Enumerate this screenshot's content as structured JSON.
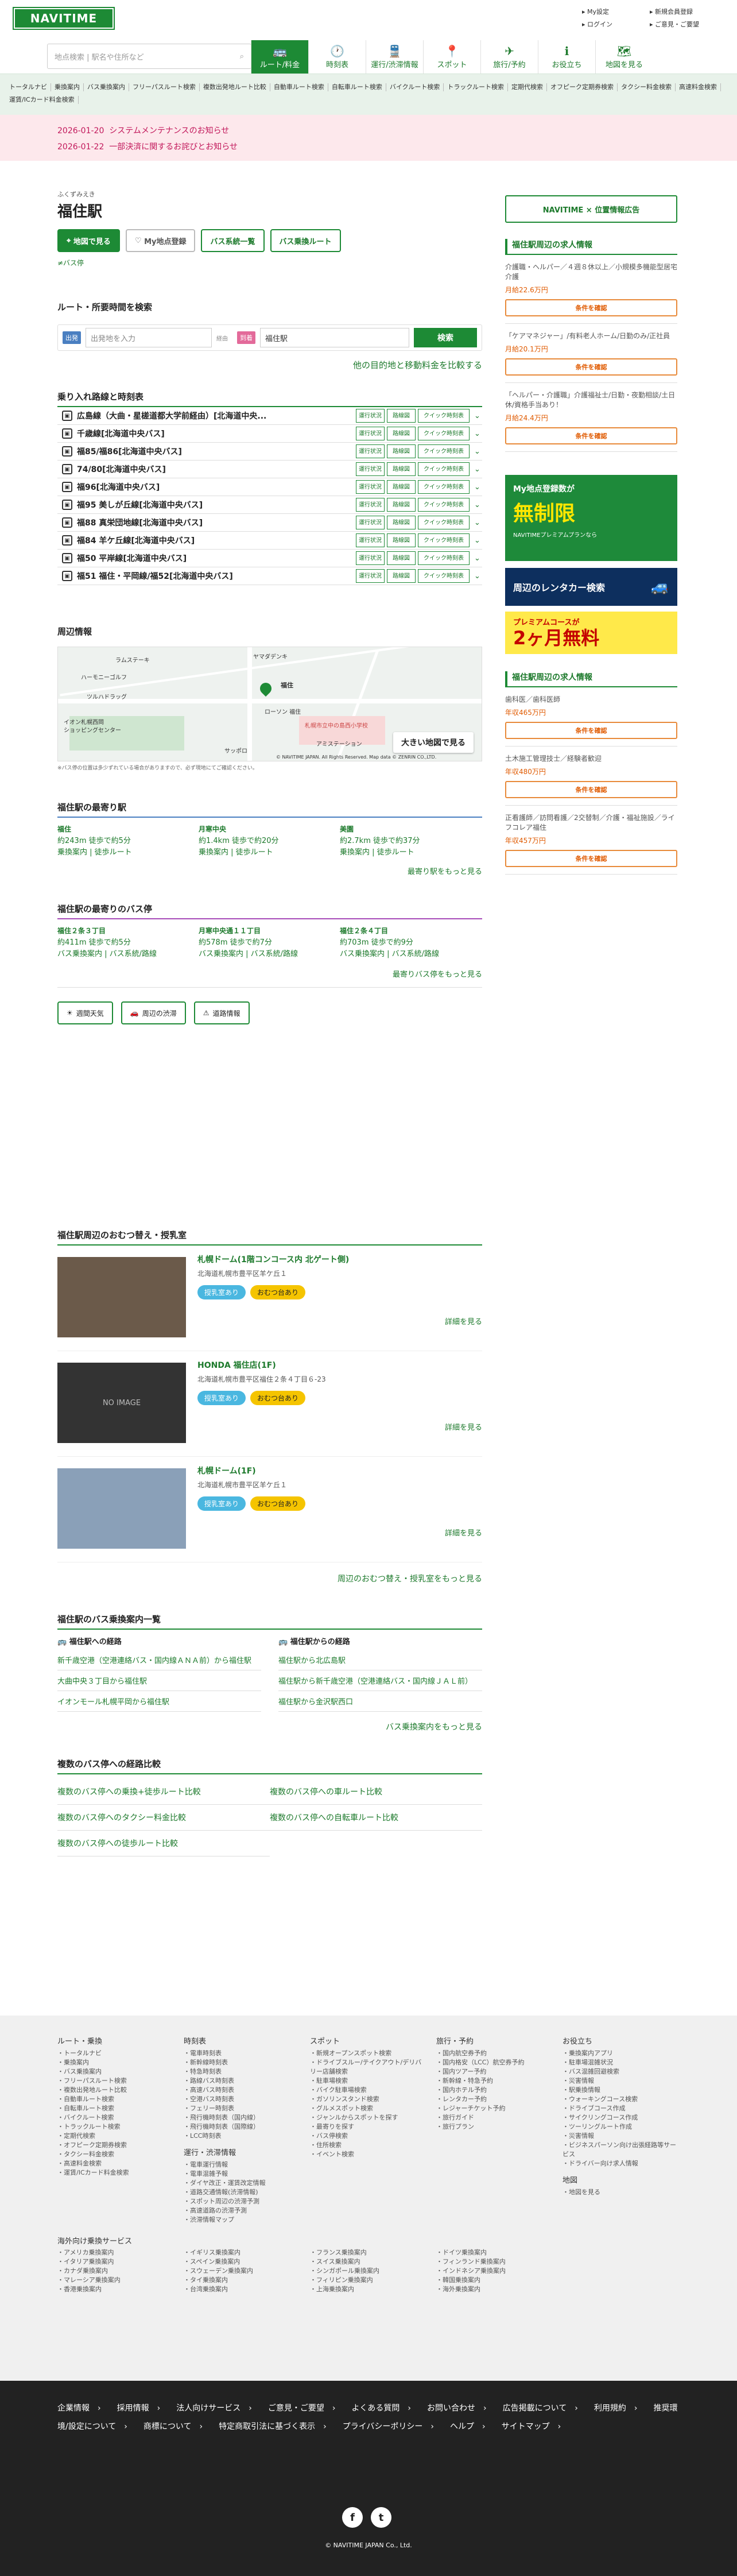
{
  "header": {
    "logo": "NAVITIME",
    "search_placeholder": "地点検索 | 駅名や住所など",
    "top_links": [
      "My設定",
      "新規会員登録",
      "ログイン",
      "ご意見・ご要望"
    ],
    "gnav": [
      {
        "icon": "bus-icon",
        "glyph": "🚌",
        "label": "ルート/料金",
        "active": true
      },
      {
        "icon": "clock-icon",
        "glyph": "🕐",
        "label": "時刻表"
      },
      {
        "icon": "train-icon",
        "glyph": "🚆",
        "label": "運行/渋滞情報"
      },
      {
        "icon": "pin-icon",
        "glyph": "📍",
        "label": "スポット"
      },
      {
        "icon": "plane-icon",
        "glyph": "✈",
        "label": "旅行/予約"
      },
      {
        "icon": "info-icon",
        "glyph": "ℹ",
        "label": "お役立ち"
      },
      {
        "icon": "map-icon",
        "glyph": "🗺",
        "label": "地図を見る"
      }
    ],
    "subnav": [
      "トータルナビ",
      "乗換案内",
      "バス乗換案内",
      "フリーパスルート検索",
      "複数出発地ルート比較",
      "自動車ルート検索",
      "自転車ルート検索",
      "バイクルート検索",
      "トラックルート検索",
      "定期代検索",
      "オフピーク定期券検索",
      "タクシー料金検索",
      "高速料金検索",
      "運賃/ICカード料金検索"
    ]
  },
  "notices": [
    {
      "date": "2026-01-20",
      "text": "システムメンテナンスのお知らせ"
    },
    {
      "date": "2026-01-22",
      "text": "一部決済に関するお詫びとお知らせ"
    }
  ],
  "station": {
    "ruby": "ふくずみえき",
    "name": "福住駅",
    "buttons": {
      "map": "地図で見る",
      "my": "My地点登録",
      "busmap": "バス系統一覧",
      "busroute": "バス乗換ルート"
    },
    "sublink": "≠バス停"
  },
  "route_search": {
    "title": "ルート・所要時間を検索",
    "from_tag": "出発",
    "from_placeholder": "出発地を入力",
    "to_tag": "到着",
    "to_value": "福住駅",
    "via": "経由",
    "button": "検索",
    "link": "他の目的地と移動料金を比較する"
  },
  "lines": {
    "title": "乗り入れ路線と時刻表",
    "status_label": "運行状況",
    "timetable_label": "路線図",
    "quick_label": "クイック時刻表",
    "items": [
      "広島線（大曲・星槎道都大学前経由）[北海道中央...",
      "千歳線[北海道中央バス]",
      "福85/福86[北海道中央バス]",
      "74/80[北海道中央バス]",
      "福96[北海道中央バス]",
      "福95 美しが丘線[北海道中央バス]",
      "福88 真栄団地線[北海道中央バス]",
      "福84 羊ケ丘線[北海道中央バス]",
      "福50 平岸線[北海道中央バス]",
      "福51 福住・平岡線/福52[北海道中央バス]"
    ]
  },
  "nearby_map": {
    "title": "周辺情報",
    "labels": [
      "ヤマダデンキ",
      "ラムステーキ",
      "ハーモニーゴルフ",
      "ツルハドラッグ",
      "イオン札幌西岡",
      "ショッピングセンター",
      "ローソン 福住",
      "サッポロ",
      "札幌市立中の島西小学校",
      "アミステーション",
      "福住"
    ],
    "big_button": "大きい地図で見る",
    "copyright": "© NAVITIME JAPAN. All Rights Reserved. Map data © ZENRIN CO.,LTD.",
    "note": "※バス停の位置は多少ずれている場合がありますので、必ず現地にてご確認ください。"
  },
  "near_stations": {
    "title": "福住駅の最寄り駅",
    "items": [
      {
        "name": "福住",
        "dist": "約243m 徒歩で約5分",
        "links": "乗換案内 | 徒歩ルート"
      },
      {
        "name": "月寒中央",
        "dist": "約1.4km 徒歩で約20分",
        "links": "乗換案内 | 徒歩ルート"
      },
      {
        "name": "美園",
        "dist": "約2.7km 徒歩で約37分",
        "links": "乗換案内 | 徒歩ルート"
      }
    ],
    "more": "最寄り駅をもっと見る"
  },
  "near_stops": {
    "title": "福住駅の最寄りのバス停",
    "items": [
      {
        "name": "福住２条３丁目",
        "dist": "約411m 徒歩で約5分",
        "links": "バス乗換案内 | バス系統/路線"
      },
      {
        "name": "月寒中央通１１丁目",
        "dist": "約578m 徒歩で約7分",
        "links": "バス乗換案内 | バス系統/路線"
      },
      {
        "name": "福住２条４丁目",
        "dist": "約703m 徒歩で約9分",
        "links": "バス乗換案内 | バス系統/路線"
      }
    ],
    "more": "最寄りバス停をもっと見る"
  },
  "info_buttons": [
    "週間天気",
    "周辺の渋滞",
    "道路情報"
  ],
  "spots": {
    "title": "福住駅周辺のおむつ替え・授乳室",
    "tag1": "授乳室あり",
    "tag2": "おむつ台あり",
    "detail": "詳細を見る",
    "no_image": "NO IMAGE",
    "items": [
      {
        "name": "札幌ドーム(1階コンコース内 北ゲート側)",
        "addr": "北海道札幌市豊平区羊ケ丘１"
      },
      {
        "name": "HONDA 福住店(1F)",
        "addr": "北海道札幌市豊平区福住２条４丁目６-23"
      },
      {
        "name": "札幌ドーム(1F)",
        "addr": "北海道札幌市豊平区羊ケ丘１"
      }
    ],
    "more": "周辺のおむつ替え・授乳室をもっと見る"
  },
  "bus_routes": {
    "title": "福住駅のバス乗換案内一覧",
    "to_head": "福住駅への経路",
    "from_head": "福住駅からの経路",
    "to": [
      "新千歳空港（空港連絡バス・国内線ＡＮＡ前）から福住駅",
      "大曲中央３丁目から福住駅",
      "イオンモール札幌平岡から福住駅"
    ],
    "from": [
      "福住駅から北広島駅",
      "福住駅から新千歳空港（空港連絡バス・国内線ＪＡＬ前）",
      "福住駅から金沢駅西口"
    ],
    "more": "バス乗換案内をもっと見る"
  },
  "compare": {
    "title": "複数のバス停への経路比較",
    "items": [
      "複数のバス停への乗換+徒歩ルート比較",
      "複数のバス停への車ルート比較",
      "複数のバス停へのタクシー料金比較",
      "複数のバス停への自転車ルート比較",
      "複数のバス停への徒歩ルート比較"
    ]
  },
  "side": {
    "navad": "NAVITIME × 位置情報広告",
    "jobs_title": "福住駅周辺の求人情報",
    "job_button": "条件を確認",
    "jobs1": [
      {
        "t": "介護職・ヘルパー／４週８休以上／小規模多機能型居宅介護",
        "p": "月給22.6万円"
      },
      {
        "t": "「ケアマネジャー」/有料老人ホーム/日勤のみ/正社員",
        "p": "月給20.1万円"
      },
      {
        "t": "「ヘルパー・介護職」介護福祉士/日勤・夜勤相談/土日休/資格手当あり！",
        "p": "月給24.4万円"
      }
    ],
    "ad1_title": "My地点登録数が",
    "ad1_big": "無制限",
    "ad1_sub": "NAVITIMEプレミアムプランなら",
    "rent": "周辺のレンタカー検索",
    "prem_small": "プレミアムコースが",
    "prem_big": "2ヶ月無料",
    "jobs2": [
      {
        "t": "歯科医／歯科医師",
        "p": "年収465万円"
      },
      {
        "t": "土木施工管理技士／経験者歓迎",
        "p": "年収480万円"
      },
      {
        "t": "正看護師／訪問看護／2交替制／介護・福祉施設／ライフコレア福住",
        "p": "年収457万円"
      }
    ]
  },
  "footer": {
    "cols": [
      {
        "h": "ルート・乗換",
        "items": [
          "トータルナビ",
          "乗換案内",
          "バス乗換案内",
          "フリーパスルート検索",
          "複数出発地ルート比較",
          "自動車ルート検索",
          "自転車ルート検索",
          "バイクルート検索",
          "トラックルート検索",
          "定期代検索",
          "オフピーク定期券検索",
          "タクシー料金検索",
          "高速料金検索",
          "運賃/ICカード料金検索"
        ]
      },
      {
        "h": "時刻表",
        "items": [
          "電車時刻表",
          "新幹線時刻表",
          "特急時刻表",
          "路線バス時刻表",
          "高速バス時刻表",
          "空港バス時刻表",
          "フェリー時刻表",
          "飛行機時刻表（国内線）",
          "飛行機時刻表（国際線）",
          "LCC時刻表"
        ]
      },
      {
        "h": "スポット",
        "items": [
          "新規オープンスポット検索",
          "ドライブスルー/テイクアウト/デリバリー店舗検索",
          "駐車場検索",
          "バイク駐車場検索",
          "ガソリンスタンド検索",
          "グルメスポット検索",
          "ジャンルからスポットを探す",
          "最寄りを探す",
          "バス停検索",
          "住所検索",
          "イベント検索"
        ]
      },
      {
        "h": "旅行・予約",
        "items": [
          "国内航空券予約",
          "国内格安（LCC）航空券予約",
          "国内ツアー予約",
          "新幹線・特急予約",
          "国内ホテル予約",
          "レンタカー予約",
          "レジャーチケット予約",
          "旅行ガイド",
          "旅行プラン"
        ]
      },
      {
        "h": "お役立ち",
        "items": [
          "乗換案内アプリ",
          "駐車場混雑状況",
          "バス混雑回避検索",
          "災害情報",
          "駅乗換情報",
          "ウォーキングコース検索",
          "ドライブコース作成",
          "サイクリングコース作成",
          "ツーリングルート作成",
          "災害情報",
          "ビジネスパーソン向け出張経路等サービス",
          "ドライバー向け求人情報"
        ]
      }
    ],
    "col2b": {
      "h": "運行・渋滞情報",
      "items": [
        "電車運行情報",
        "電車混雑予報",
        "ダイヤ改正・運賃改定情報",
        "道路交通情報(渋滞情報)",
        "スポット周辺の渋滞予測",
        "高速道路の渋滞予測",
        "渋滞情報マップ"
      ]
    },
    "col5b": {
      "h": "地図",
      "items": [
        "地図を見る"
      ]
    },
    "intl_title": "海外向け乗換サービス",
    "intl": [
      [
        "アメリカ乗換案内",
        "イタリア乗換案内",
        "カナダ乗換案内",
        "マレーシア乗換案内",
        "香港乗換案内"
      ],
      [
        "イギリス乗換案内",
        "スペイン乗換案内",
        "スウェーデン乗換案内",
        "タイ乗換案内",
        "台湾乗換案内"
      ],
      [
        "フランス乗換案内",
        "スイス乗換案内",
        "シンガポール乗換案内",
        "フィリピン乗換案内",
        "上海乗換案内"
      ],
      [
        "ドイツ乗換案内",
        "フィンランド乗換案内",
        "インドネシア乗換案内",
        "韓国乗換案内",
        "海外乗換案内"
      ]
    ],
    "bottom_links": [
      "企業情報",
      "採用情報",
      "法人向けサービス",
      "ご意見・ご要望",
      "よくある質問",
      "お問い合わせ",
      "広告掲載について",
      "利用規約",
      "推奨環境/設定について",
      "商標について",
      "特定商取引法に基づく表示",
      "プライバシーポリシー",
      "ヘルプ",
      "サイトマップ"
    ],
    "copyright": "© NAVITIME JAPAN Co., Ltd."
  }
}
